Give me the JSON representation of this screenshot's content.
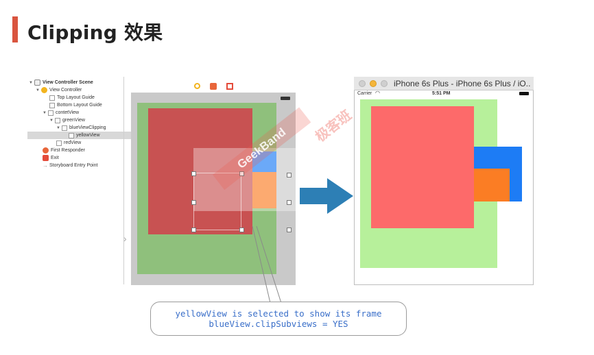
{
  "slide": {
    "title": "Clipping 效果"
  },
  "navigator": {
    "scene": "View Controller Scene",
    "items": [
      "View Controller",
      "Top Layout Guide",
      "Bottom Layout Guide",
      "contetView",
      "greenView",
      "blueViewClipping",
      "yellowView",
      "redView",
      "First Responder",
      "Exit",
      "Storyboard Entry Point"
    ],
    "selected": "yellowView"
  },
  "simulator": {
    "window_title": "iPhone 6s Plus - iPhone 6s Plus / iO...",
    "carrier": "Carrier",
    "time": "5:51 PM"
  },
  "callout": {
    "line1": "yellowView is selected to show its frame",
    "line2": "blueView.clipSubviews = YES"
  },
  "watermark": {
    "brand": "GeekBand",
    "cn": "极客班"
  },
  "icons": [
    "view-controller-icon",
    "first-responder-icon",
    "exit-icon",
    "entry-point-arrow-icon",
    "battery-icon",
    "wifi-icon"
  ],
  "colors": {
    "accent": "#d9553f",
    "green": "#b7f09b",
    "green_dim": "#8fc07c",
    "red": "#fd6a6a",
    "red_dim": "#c85252",
    "blue": "#1d7cf5",
    "orange": "#fb7d24",
    "arrow": "#2d7fb5",
    "callout_text": "#3a6fc9"
  }
}
